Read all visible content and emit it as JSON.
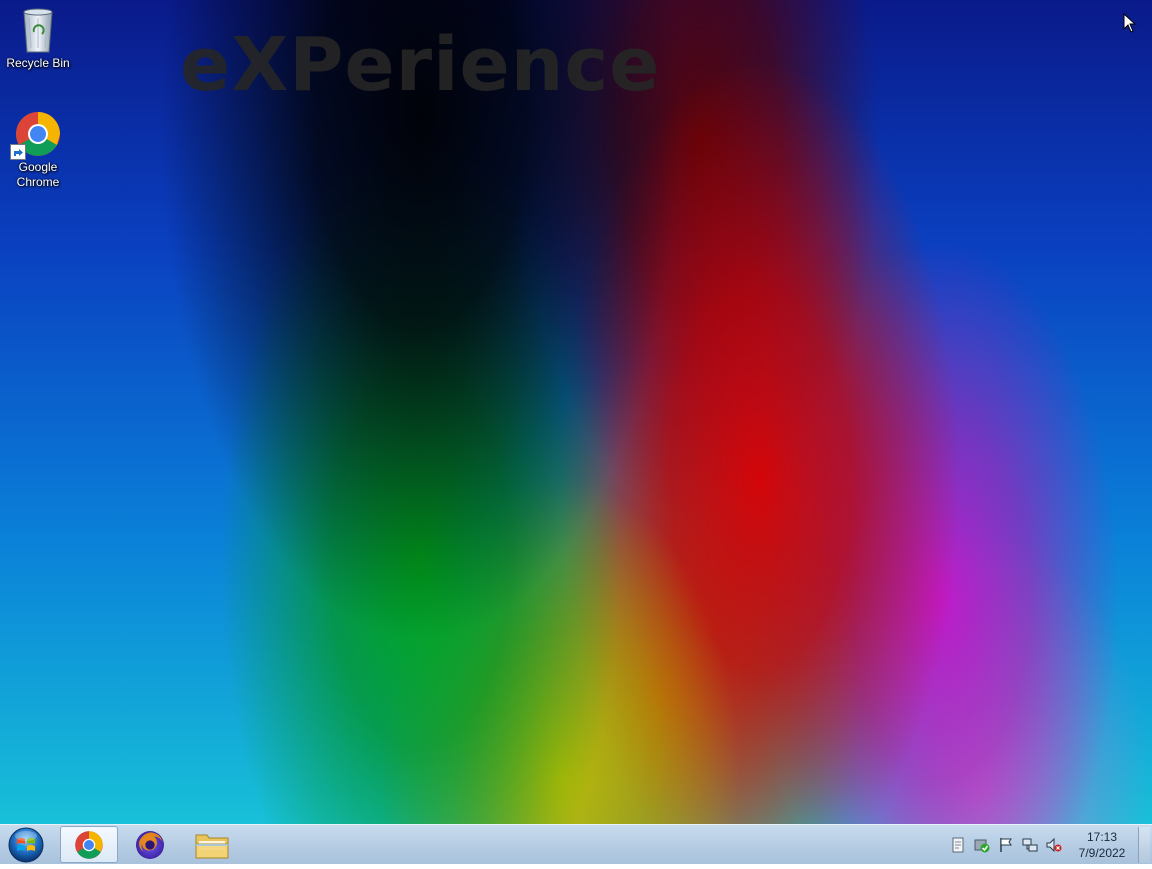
{
  "desktop": {
    "watermark_text": "eXPerience",
    "icons": [
      {
        "label": "Recycle Bin",
        "icon": "recycle-bin-icon"
      },
      {
        "label": "Google Chrome",
        "icon": "chrome-icon"
      }
    ]
  },
  "taskbar": {
    "start_icon": "windows-orb-icon",
    "pinned": [
      {
        "name": "Google Chrome",
        "icon": "chrome-icon",
        "active": true
      },
      {
        "name": "Firefox",
        "icon": "firefox-icon",
        "active": false
      },
      {
        "name": "File Explorer",
        "icon": "folder-icon",
        "active": false
      }
    ],
    "tray_icons": [
      "notes-icon",
      "security-check-icon",
      "action-center-flag-icon",
      "network-icon",
      "volume-muted-icon"
    ],
    "clock": {
      "time": "17:13",
      "date": "7/9/2022"
    }
  }
}
